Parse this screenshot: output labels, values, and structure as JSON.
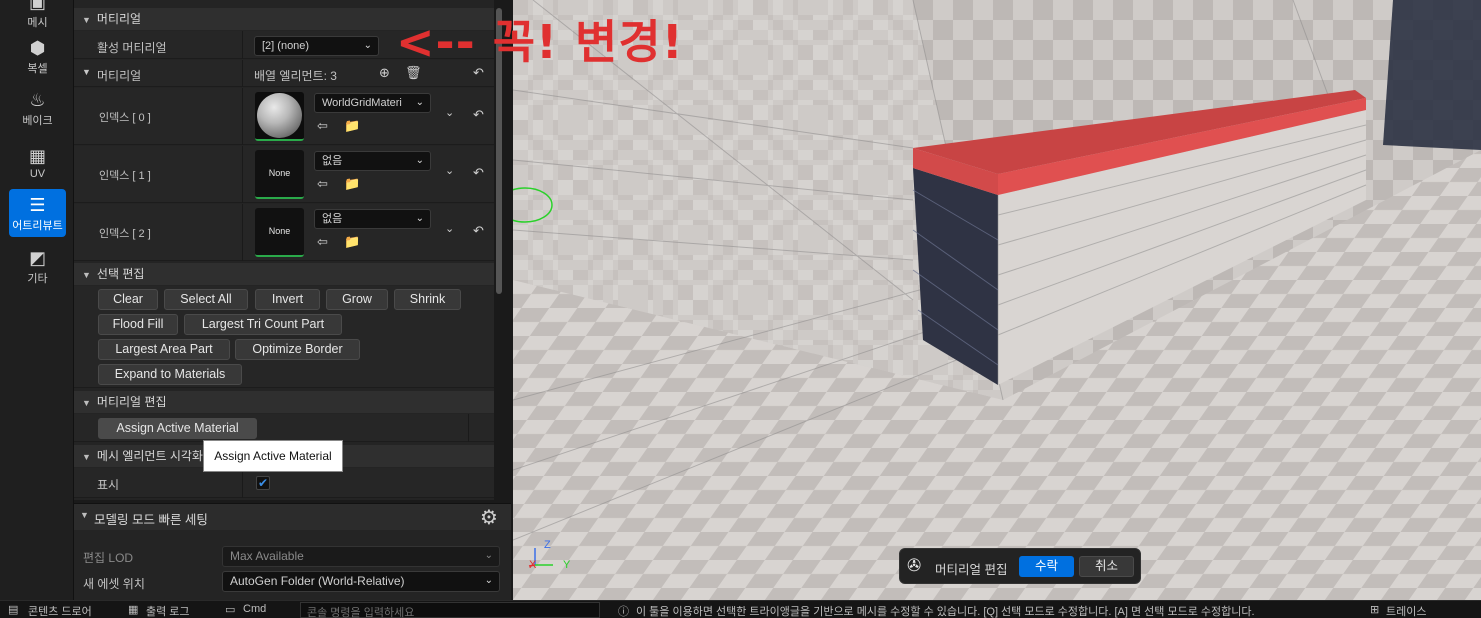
{
  "toolbar": {
    "items": [
      {
        "label": "메시",
        "icon": "mesh-icon"
      },
      {
        "label": "복셀",
        "icon": "voxel-icon"
      },
      {
        "label": "베이크",
        "icon": "bake-icon"
      },
      {
        "label": "UV",
        "icon": "uv-icon"
      },
      {
        "label": "어트리뷰트",
        "icon": "attributes-icon",
        "active": true
      },
      {
        "label": "기타",
        "icon": "misc-icon"
      }
    ]
  },
  "details": {
    "material_section": "머티리얼",
    "active_material_label": "활성 머티리얼",
    "active_material_value": "[2] (none)",
    "materials_label": "머티리얼",
    "array_elements": "배열 엘리먼트: 3",
    "materials": [
      {
        "index_label": "인덱스 [ 0 ]",
        "name": "WorldGridMateri",
        "thumb": "sphere"
      },
      {
        "index_label": "인덱스 [ 1 ]",
        "name": "없음",
        "thumb": "None"
      },
      {
        "index_label": "인덱스 [ 2 ]",
        "name": "없음",
        "thumb": "None"
      }
    ],
    "selection_section": "선택 편집",
    "selection_buttons": [
      "Clear",
      "Select All",
      "Invert",
      "Grow",
      "Shrink",
      "Flood Fill",
      "Largest Tri Count Part",
      "Largest Area Part",
      "Optimize Border",
      "Expand to Materials"
    ],
    "material_edit_section": "머티리얼 편집",
    "assign_button": "Assign Active Material",
    "visualization_section": "메시 엘리먼트 시각화",
    "show_label": "표시",
    "show_checked": true
  },
  "tooltip": "Assign Active Material",
  "quick": {
    "title": "모델링 모드 빠른 세팅",
    "lod_label": "편집 LOD",
    "lod_value": "Max Available",
    "asset_label": "새 에셋 위치",
    "asset_value": "AutoGen Folder (World-Relative)"
  },
  "annotation": "<-- 꼭! 변경!",
  "accept_bar": {
    "label": "머티리얼 편집",
    "accept": "수락",
    "cancel": "취소"
  },
  "axes": {
    "z": "Z",
    "x": "X",
    "y": "Y"
  },
  "status": {
    "content_drawer": "콘텐츠 드로어",
    "output_log": "출력 로그",
    "cmd": "Cmd",
    "cmd_placeholder": "콘솔 명령을 입력하세요",
    "message": "이 툴을 이용하면 선택한 트라이앵글을 기반으로 메시를 수정할 수 있습니다. [Q] 선택 모드로 수정합니다. [A] 면 선택 모드로 수정합니다.",
    "layer": "트레이스"
  },
  "colors": {
    "accent": "#0070e0",
    "annotation": "#e03030",
    "highlight_face": "#d24a4a",
    "dark_face": "#2f3344"
  }
}
